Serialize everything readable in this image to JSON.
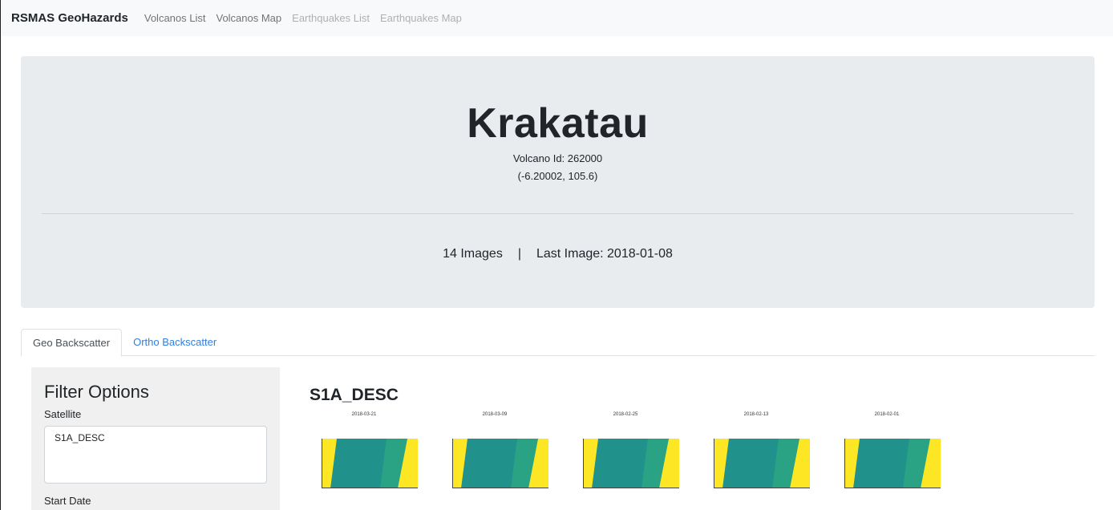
{
  "navbar": {
    "brand": "RSMAS GeoHazards",
    "links": [
      {
        "label": "Volcanos List",
        "state": "active"
      },
      {
        "label": "Volcanos Map",
        "state": "active"
      },
      {
        "label": "Earthquakes List",
        "state": "disabled"
      },
      {
        "label": "Earthquakes Map",
        "state": "disabled"
      }
    ]
  },
  "volcano": {
    "name": "Krakatau",
    "id_text": "Volcano Id: 262000",
    "coords": "(-6.20002, 105.6)",
    "images_count": "14 Images",
    "separator": "|",
    "last_image": "Last Image: 2018-01-08"
  },
  "tabs": [
    {
      "label": "Geo Backscatter",
      "active": true
    },
    {
      "label": "Ortho Backscatter",
      "active": false
    }
  ],
  "filter": {
    "title": "Filter Options",
    "satellite_label": "Satellite",
    "satellite_value": "S1A_DESC",
    "start_date_label": "Start Date"
  },
  "results": {
    "title": "S1A_DESC",
    "thumbnails": [
      {
        "date": "2018-03-21"
      },
      {
        "date": "2018-03-09"
      },
      {
        "date": "2018-02-25"
      },
      {
        "date": "2018-02-13"
      },
      {
        "date": "2018-02-01"
      }
    ]
  },
  "colors": {
    "navbar_bg": "#f8f9fa",
    "jumbotron_bg": "#e9ecef",
    "link_blue": "#2f7fe0",
    "plot_yellow": "#fde725",
    "plot_teal": "#21918c",
    "plot_green": "#35b779"
  }
}
